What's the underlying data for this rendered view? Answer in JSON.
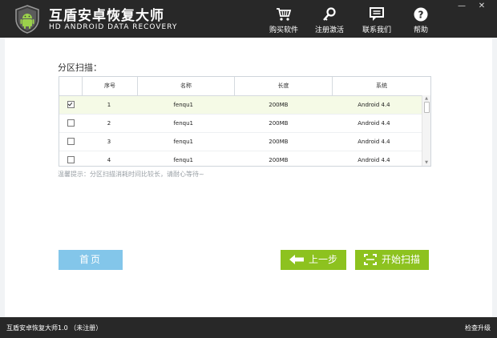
{
  "app": {
    "title": "互盾安卓恢复大师",
    "subtitle": "HD ANDROID DATA RECOVERY"
  },
  "toolbar": {
    "buy": "购买软件",
    "register": "注册激活",
    "contact": "联系我们",
    "help": "帮助"
  },
  "section_title": "分区扫描：",
  "table": {
    "headers": [
      "序号",
      "名称",
      "长度",
      "系统"
    ],
    "rows": [
      {
        "checked": true,
        "index": "1",
        "name": "fenqu1",
        "size": "200MB",
        "system": "Android 4.4"
      },
      {
        "checked": false,
        "index": "2",
        "name": "fenqu1",
        "size": "200MB",
        "system": "Android 4.4"
      },
      {
        "checked": false,
        "index": "3",
        "name": "fenqu1",
        "size": "200MB",
        "system": "Android 4.4"
      },
      {
        "checked": false,
        "index": "4",
        "name": "fenqu1",
        "size": "200MB",
        "system": "Android 4.4"
      }
    ]
  },
  "hint": "温馨提示：分区扫描消耗时间比较长，请耐心等待~",
  "buttons": {
    "home": "首页",
    "prev": "上一步",
    "scan": "开始扫描"
  },
  "status": {
    "version": "互盾安卓恢复大师1.0 （未注册）",
    "check_update": "检查升级"
  },
  "colors": {
    "titlebar": "#282828",
    "accent_green": "#8dc21f",
    "accent_blue": "#83c6ea",
    "selected_row": "#f5fae6"
  }
}
